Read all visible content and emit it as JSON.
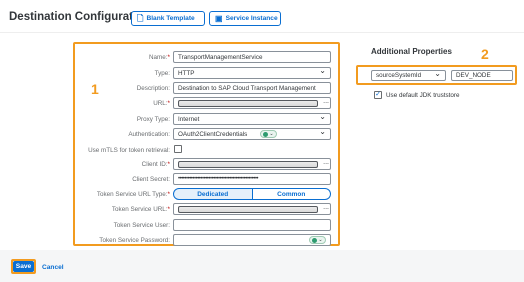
{
  "header": {
    "title": "Destination Configuration",
    "blank_template_label": "Blank Template",
    "service_instance_label": "Service Instance"
  },
  "annotations": {
    "box1": "1",
    "box2": "2"
  },
  "form": {
    "name_label": "Name:",
    "name_value": "TransportManagementService",
    "type_label": "Type:",
    "type_value": "HTTP",
    "description_label": "Description:",
    "description_value": "Destination to SAP Cloud Transport Management",
    "url_label": "URL:",
    "proxy_label": "Proxy Type:",
    "proxy_value": "Internet",
    "auth_label": "Authentication:",
    "auth_value": "OAuth2ClientCredentials",
    "mtls_label": "Use mTLS for token retrieval:",
    "client_id_label": "Client ID:",
    "client_secret_label": "Client Secret:",
    "client_secret_value": "••••••••••••••••••••••••••••••••••••••••••••••••••",
    "token_url_type_label": "Token Service URL Type:",
    "token_url_type_options": [
      "Dedicated",
      "Common"
    ],
    "token_url_label": "Token Service URL:",
    "token_user_label": "Token Service User:",
    "token_password_label": "Token Service Password:",
    "required_mark": "*",
    "ellipsis": "..."
  },
  "additional": {
    "title": "Additional Properties",
    "property_key": "sourceSystemId",
    "property_value": "DEV_NODE",
    "jdk_truststore_label": "Use default JDK truststore",
    "jdk_truststore_checked": true
  },
  "footer": {
    "save_label": "Save",
    "cancel_label": "Cancel"
  },
  "colors": {
    "accent": "#0a6ed1",
    "highlight": "#f29b1f"
  }
}
